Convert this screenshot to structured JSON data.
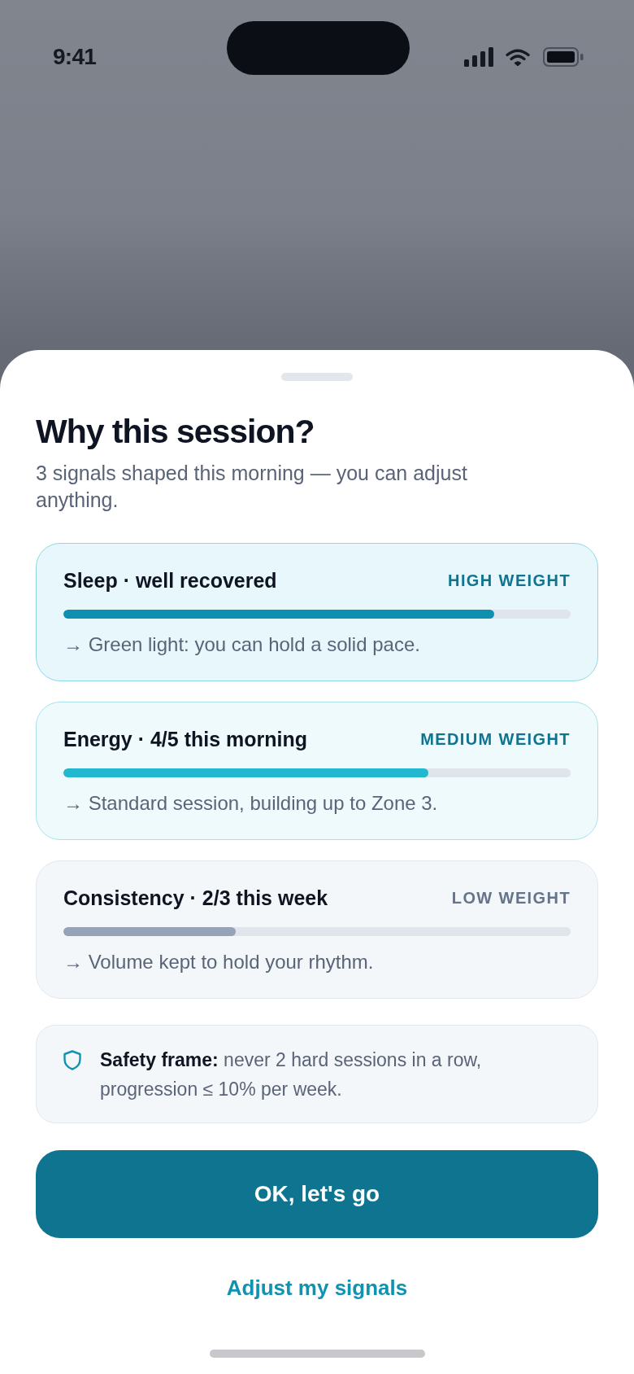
{
  "status_bar": {
    "time": "9:41"
  },
  "sheet": {
    "title": "Why this session?",
    "subtitle": "3 signals shaped this morning — you can adjust anything.",
    "signals": [
      {
        "kind": "high",
        "title": "Sleep · well recovered",
        "weight": "HIGH WEIGHT",
        "level": 0.85,
        "note": "→ Green light: you can hold a solid pace."
      },
      {
        "kind": "medium",
        "title": "Energy · 4/5 this morning",
        "weight": "MEDIUM WEIGHT",
        "level": 0.72,
        "note": "→ Standard session, building up to Zone 3."
      },
      {
        "kind": "low",
        "title": "Consistency · 2/3 this week",
        "weight": "LOW WEIGHT",
        "level": 0.34,
        "note": "→ Volume kept to hold your rhythm."
      }
    ],
    "safety_note": "**Safety frame:** never 2 hard sessions in a row, progression ≤ 10% per week.",
    "primary_button": "OK, let's go",
    "secondary_link": "Adjust my signals"
  }
}
